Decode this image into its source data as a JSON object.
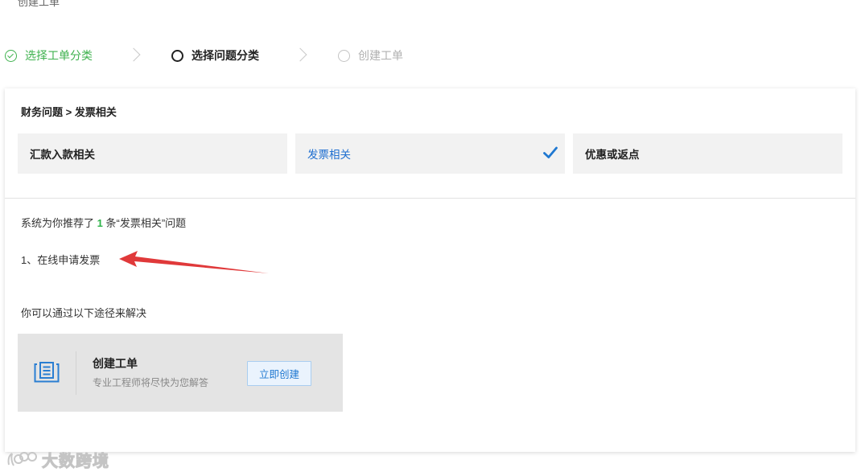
{
  "top_text": "创建工单",
  "steps": [
    {
      "label": "选择工单分类",
      "state": "done"
    },
    {
      "label": "选择问题分类",
      "state": "active"
    },
    {
      "label": "创建工单",
      "state": "pending"
    }
  ],
  "breadcrumb": "财务问题 > 发票相关",
  "categories": [
    {
      "label": "汇款入款相关"
    },
    {
      "label": "发票相关",
      "selected": true
    },
    {
      "label": "优惠或返点"
    }
  ],
  "recommend": {
    "prefix": "系统为你推荐了",
    "count": "1",
    "suffix": "条“发票相关”问题"
  },
  "items": [
    "1、在线申请发票"
  ],
  "ways_label": "你可以通过以下途径来解决",
  "ticket_panel": {
    "title": "创建工单",
    "desc": "专业工程师将尽快为您解答",
    "button": "立即创建"
  },
  "watermark": "大数跨境",
  "colors": {
    "done_green": "#3fb24f",
    "accent_blue": "#1f78d1",
    "arrow_red": "#e0393a"
  }
}
